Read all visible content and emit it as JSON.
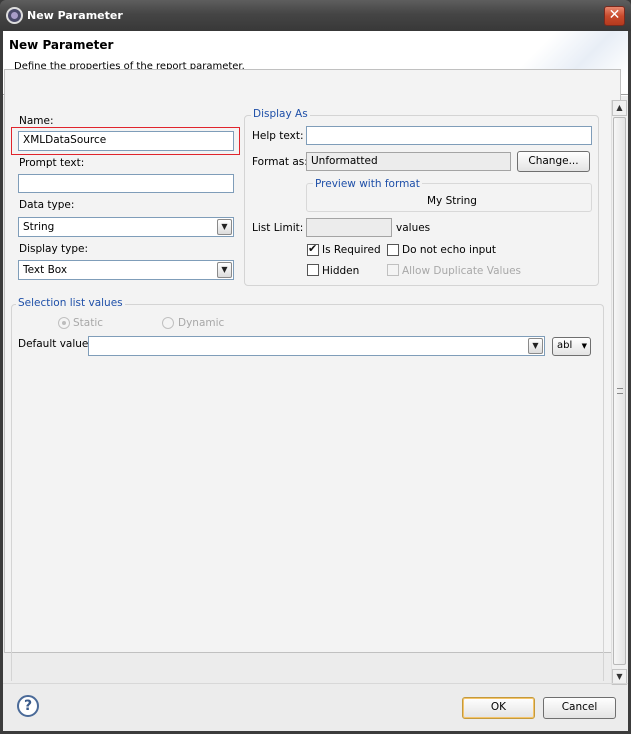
{
  "window": {
    "title": "New Parameter",
    "close_glyph": "✕"
  },
  "header": {
    "title": "New Parameter",
    "description": "Define the properties of the report parameter."
  },
  "left": {
    "name_label": "Name:",
    "name_value": "XMLDataSource",
    "prompt_label": "Prompt text:",
    "prompt_value": "",
    "data_type_label": "Data type:",
    "data_type_value": "String",
    "display_type_label": "Display type:",
    "display_type_value": "Text Box"
  },
  "display_as": {
    "group_title": "Display As",
    "help_text_label": "Help text:",
    "help_text_value": "",
    "format_as_label": "Format as:",
    "format_as_value": "Unformatted",
    "change_button": "Change...",
    "preview_title": "Preview with format",
    "preview_value": "My String",
    "list_limit_label": "List Limit:",
    "list_limit_value": "",
    "list_limit_suffix": "values",
    "is_required": {
      "label": "Is Required",
      "checked": true
    },
    "do_not_echo": {
      "label": "Do not echo input",
      "checked": false
    },
    "hidden": {
      "label": "Hidden",
      "checked": false
    },
    "allow_duplicates": {
      "label": "Allow Duplicate Values",
      "checked": false,
      "enabled": false
    }
  },
  "selection": {
    "group_title": "Selection list values",
    "static_label": "Static",
    "dynamic_label": "Dynamic",
    "default_value_label": "Default value:",
    "default_value": "",
    "expr_button": "abl"
  },
  "footer": {
    "ok": "OK",
    "cancel": "Cancel"
  },
  "colors": {
    "accent": "#1e4fa8",
    "highlight": "#e0242c"
  },
  "icons": {
    "help": "help-icon",
    "window": "app-icon",
    "close": "close-icon"
  }
}
